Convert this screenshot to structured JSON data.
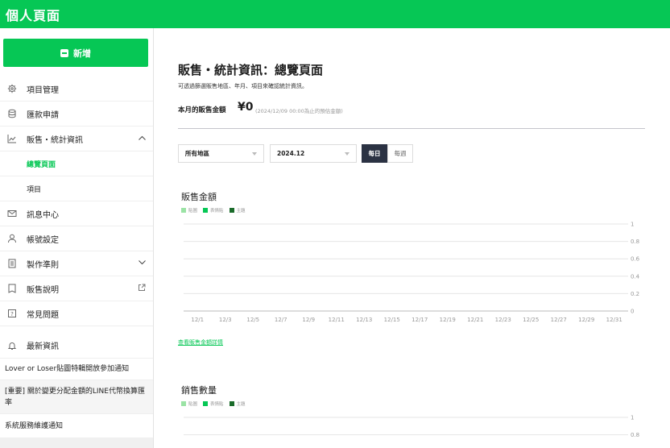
{
  "header": {
    "title": "個人頁面"
  },
  "sidebar": {
    "new_button": "新增",
    "items": [
      {
        "label": "項目管理",
        "icon": "gear-icon"
      },
      {
        "label": "匯款申請",
        "icon": "database-icon"
      },
      {
        "label": "販售・統計資訊",
        "icon": "chart-icon",
        "chevron": "up"
      },
      {
        "label": "總覽頁面",
        "sub": true,
        "active": true
      },
      {
        "label": "項目",
        "sub": true
      },
      {
        "label": "訊息中心",
        "icon": "mail-icon"
      },
      {
        "label": "帳號設定",
        "icon": "user-icon"
      },
      {
        "label": "製作準則",
        "icon": "document-icon",
        "chevron": "down"
      },
      {
        "label": "販售說明",
        "icon": "book-icon",
        "external": true
      },
      {
        "label": "常見問題",
        "icon": "question-icon"
      },
      {
        "label": "最新資訊",
        "icon": "bell-icon"
      }
    ],
    "news": [
      "Lover or Loser貼圖特輯開放參加通知",
      "[重要] 關於變更分配金額的LINE代幣換算匯率",
      "系統服務維護通知"
    ]
  },
  "main": {
    "title": "販售・統計資訊：總覽頁面",
    "description": "可透過篩選販售地區、年月、項目來確認統計資訊。",
    "monthly_sales_label": "本月的販售金額",
    "monthly_sales_value": "¥0",
    "monthly_sales_note": "(2024/12/09 00:00為止的預估金額)",
    "filters": {
      "region": "所有地區",
      "month": "2024.12",
      "daily": "每日",
      "weekly": "每週",
      "selected": "daily"
    },
    "detail_link": "查看販售金額詳情"
  },
  "colors": {
    "brand": "#06c755",
    "sticker": "#9be3a5",
    "emoji": "#06c755",
    "theme": "#1a6b2a",
    "toggle_active": "#2b3243"
  },
  "chart_data": [
    {
      "type": "bar",
      "title": "販售金額",
      "legend": [
        "貼圖",
        "表情貼",
        "主題"
      ],
      "categories": [
        "12/1",
        "12/3",
        "12/5",
        "12/7",
        "12/9",
        "12/11",
        "12/13",
        "12/15",
        "12/17",
        "12/19",
        "12/21",
        "12/23",
        "12/25",
        "12/27",
        "12/29",
        "12/31"
      ],
      "yticks": [
        "0",
        "0.2",
        "0.4",
        "0.6",
        "0.8",
        "1"
      ],
      "ylim": [
        0,
        1
      ],
      "series": [
        {
          "name": "貼圖",
          "values": [
            0,
            0,
            0,
            0,
            0,
            0,
            0,
            0,
            0,
            0,
            0,
            0,
            0,
            0,
            0,
            0
          ]
        },
        {
          "name": "表情貼",
          "values": [
            0,
            0,
            0,
            0,
            0,
            0,
            0,
            0,
            0,
            0,
            0,
            0,
            0,
            0,
            0,
            0
          ]
        },
        {
          "name": "主題",
          "values": [
            0,
            0,
            0,
            0,
            0,
            0,
            0,
            0,
            0,
            0,
            0,
            0,
            0,
            0,
            0,
            0
          ]
        }
      ],
      "grid": true
    },
    {
      "type": "bar",
      "title": "銷售數量",
      "legend": [
        "貼圖",
        "表情貼",
        "主題"
      ],
      "yticks": [
        "1",
        "0.8"
      ],
      "ylim": [
        0,
        1
      ],
      "grid": true
    }
  ]
}
